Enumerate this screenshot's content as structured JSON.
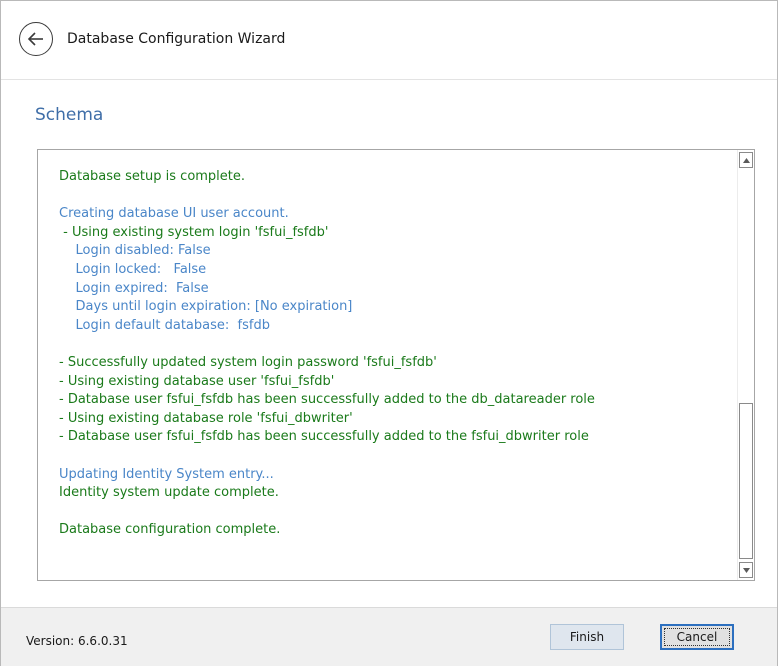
{
  "header": {
    "title": "Database Configuration Wizard"
  },
  "section": {
    "title": "Schema"
  },
  "log": {
    "lines": [
      {
        "text": "Database setup is complete.",
        "color": "green"
      },
      {
        "text": "",
        "color": "green"
      },
      {
        "text": "Creating database UI user account.",
        "color": "blue"
      },
      {
        "text": " - Using existing system login 'fsfui_fsfdb'",
        "color": "green"
      },
      {
        "text": "    Login disabled: False",
        "color": "blue"
      },
      {
        "text": "    Login locked:   False",
        "color": "blue"
      },
      {
        "text": "    Login expired:  False",
        "color": "blue"
      },
      {
        "text": "    Days until login expiration: [No expiration]",
        "color": "blue"
      },
      {
        "text": "    Login default database:  fsfdb",
        "color": "blue"
      },
      {
        "text": "",
        "color": "green"
      },
      {
        "text": "- Successfully updated system login password 'fsfui_fsfdb'",
        "color": "green"
      },
      {
        "text": "- Using existing database user 'fsfui_fsfdb'",
        "color": "green"
      },
      {
        "text": "- Database user fsfui_fsfdb has been successfully added to the db_datareader role",
        "color": "green"
      },
      {
        "text": "- Using existing database role 'fsfui_dbwriter'",
        "color": "green"
      },
      {
        "text": "- Database user fsfui_fsfdb has been successfully added to the fsfui_dbwriter role",
        "color": "green"
      },
      {
        "text": "",
        "color": "green"
      },
      {
        "text": "Updating Identity System entry...",
        "color": "blue"
      },
      {
        "text": "Identity system update complete.",
        "color": "green"
      },
      {
        "text": "",
        "color": "green"
      },
      {
        "text": "Database configuration complete.",
        "color": "green"
      }
    ]
  },
  "footer": {
    "version": "Version: 6.6.0.31",
    "finish_label": "Finish",
    "cancel_label": "Cancel"
  },
  "icons": {
    "back": "arrow-left-circle-icon",
    "scroll_up": "triangle-up-icon",
    "scroll_down": "triangle-down-icon"
  },
  "colors": {
    "log_green": "#1a7a1a",
    "log_blue": "#4a86c8",
    "section_title": "#3f6ea8",
    "cancel_focus": "#2c6fbf"
  }
}
